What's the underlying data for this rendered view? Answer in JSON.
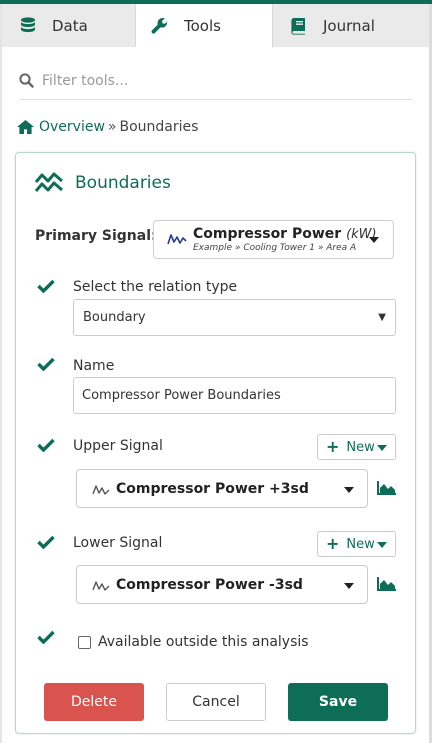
{
  "tabs": [
    {
      "label": "Data",
      "icon": "database-icon"
    },
    {
      "label": "Tools",
      "icon": "wrench-icon",
      "active": true
    },
    {
      "label": "Journal",
      "icon": "book-icon"
    }
  ],
  "filter": {
    "placeholder": "Filter tools..."
  },
  "breadcrumb": {
    "link": "Overview",
    "separator": "»",
    "current": "Boundaries"
  },
  "panel": {
    "title": "Boundaries",
    "title_icon": "boundaries-icon",
    "primary_signal": {
      "label": "Primary Signal:",
      "name": "Compressor Power",
      "unit": "(kW)",
      "path": "Example » Cooling Tower 1 » Area A"
    },
    "relation": {
      "label": "Select the relation type",
      "value": "Boundary"
    },
    "name_field": {
      "label": "Name",
      "value": "Compressor Power Boundaries"
    },
    "upper": {
      "label": "Upper Signal",
      "new_label": "New",
      "signal": "Compressor Power +3sd"
    },
    "lower": {
      "label": "Lower Signal",
      "new_label": "New",
      "signal": "Compressor Power -3sd"
    },
    "available": {
      "label": "Available outside this analysis",
      "checked": false
    },
    "buttons": {
      "delete": "Delete",
      "cancel": "Cancel",
      "save": "Save"
    }
  },
  "colors": {
    "accent": "#0e6d57",
    "danger": "#d9534f",
    "signal_wave": "#2b3a8c"
  }
}
